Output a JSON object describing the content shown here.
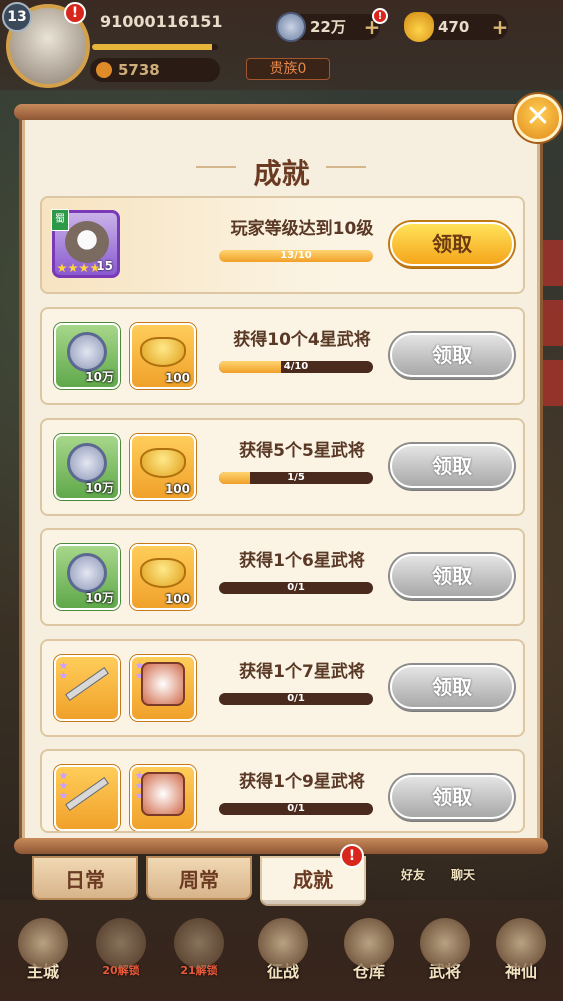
{
  "player": {
    "level": "13",
    "id": "9100011615 1",
    "power": "5738",
    "noble": "贵族0",
    "exp_fraction": 0.95
  },
  "currencies": {
    "copper": "22万",
    "gold": "470"
  },
  "panel": {
    "title": "成就"
  },
  "achievements": [
    {
      "task": "玩家等级达到10级",
      "progress": "13/10",
      "ratio": 1.0,
      "button": "领取",
      "claimable": true
    },
    {
      "task": "获得10个4星武将",
      "progress": "4/10",
      "ratio": 0.4,
      "button": "领取",
      "claimable": false,
      "rewards": [
        "10万",
        "100"
      ]
    },
    {
      "task": "获得5个5星武将",
      "progress": "1/5",
      "ratio": 0.2,
      "button": "领取",
      "claimable": false,
      "rewards": [
        "10万",
        "100"
      ]
    },
    {
      "task": "获得1个6星武将",
      "progress": "0/1",
      "ratio": 0,
      "button": "领取",
      "claimable": false,
      "rewards": [
        "10万",
        "100"
      ]
    },
    {
      "task": "获得1个7星武将",
      "progress": "0/1",
      "ratio": 0,
      "button": "领取",
      "claimable": false
    },
    {
      "task": "获得1个9星武将",
      "progress": "0/1",
      "ratio": 0,
      "button": "领取",
      "claimable": false
    }
  ],
  "hero_reward": {
    "faction": "蜀",
    "level": "15"
  },
  "tabs": [
    "日常",
    "周常",
    "成就"
  ],
  "nav": {
    "main_city": "主城",
    "lock1": "20解锁",
    "lock2": "21解锁",
    "battle": "征战",
    "warehouse": "仓库",
    "generals": "武将",
    "immortal": "神仙",
    "friends": "好友",
    "chat": "聊天"
  },
  "alert_mark": "!"
}
